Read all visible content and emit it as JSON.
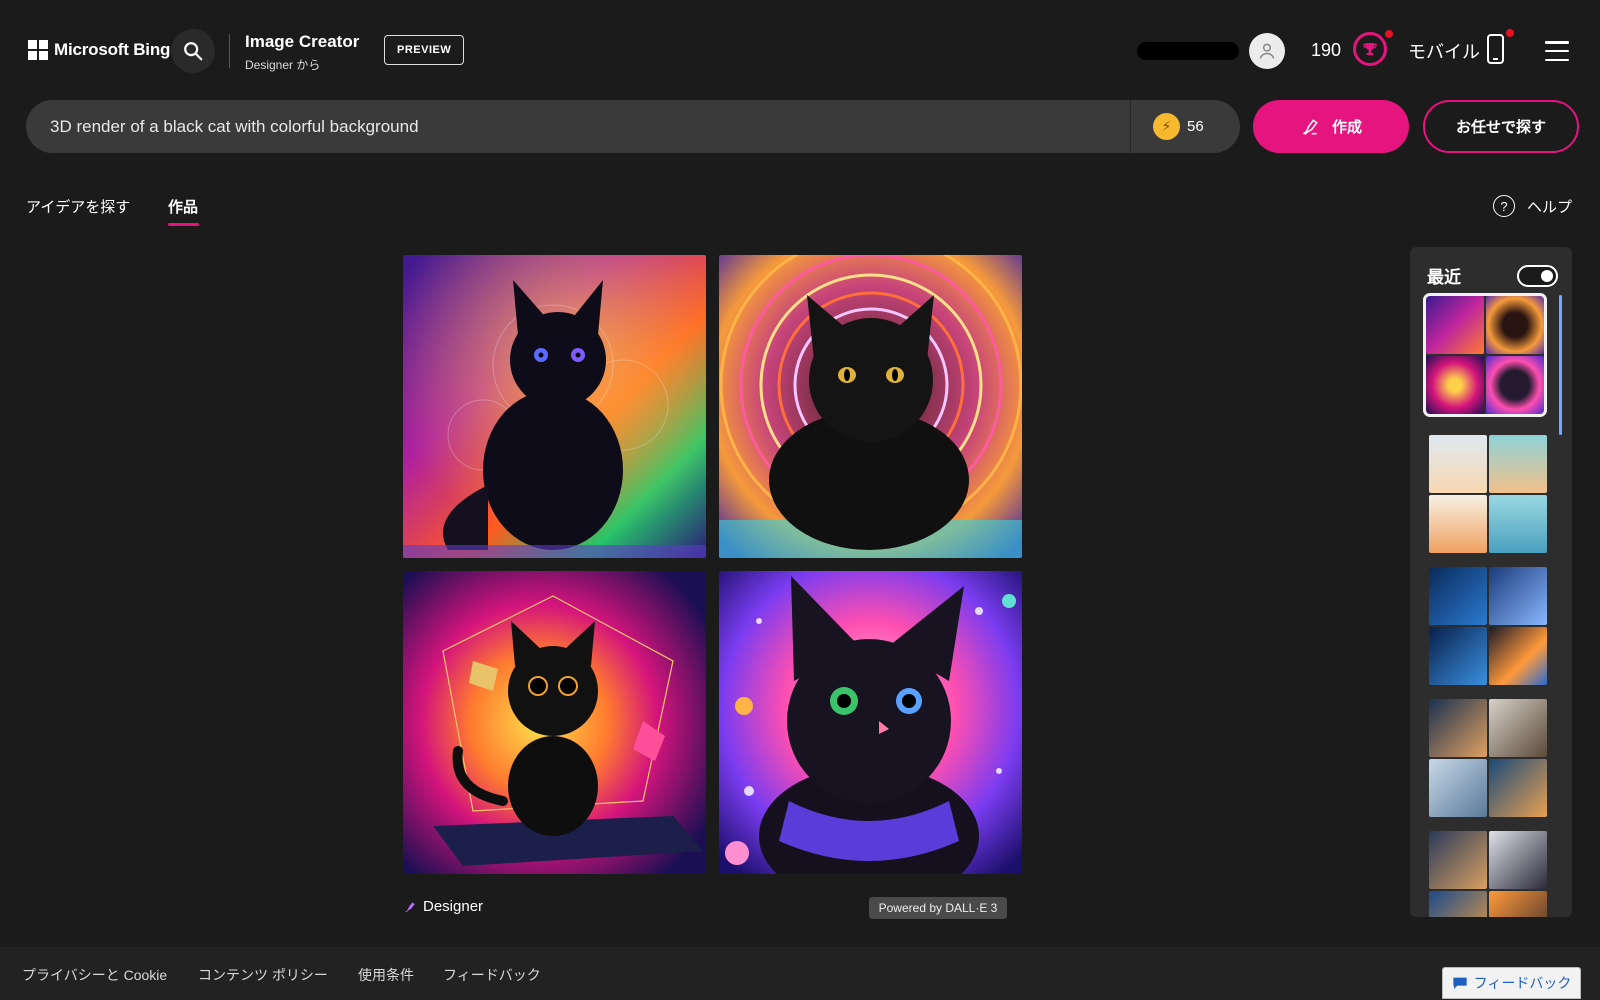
{
  "header": {
    "logo_text": "Microsoft Bing",
    "app_title": "Image Creator",
    "app_subtitle": "Designer から",
    "preview_badge": "PREVIEW",
    "points": "190",
    "mobile_label": "モバイル"
  },
  "search": {
    "query": "3D render of a black cat with colorful background",
    "boosts": "56",
    "create_label": "作成",
    "surprise_label": "お任せで探す"
  },
  "tabs": [
    {
      "label": "アイデアを探す",
      "active": false
    },
    {
      "label": "作品",
      "active": true
    }
  ],
  "help_label": "ヘルプ",
  "results": {
    "images": [
      {
        "subject": "fluffy black cat, neon rainbow background"
      },
      {
        "subject": "black cat lying, concentric neon rings"
      },
      {
        "subject": "glossy black cat figurine, geometric shapes"
      },
      {
        "subject": "black cat with purple bandana, cosmic background"
      }
    ],
    "designer_label": "Designer",
    "powered_label": "Powered by DALL·E 3"
  },
  "recent": {
    "title": "最近",
    "toggle_on": true
  },
  "footer": {
    "links": [
      "プライバシーと Cookie",
      "コンテンツ ポリシー",
      "使用条件",
      "フィードバック"
    ],
    "feedback_button": "フィードバック"
  },
  "colors": {
    "accent": "#e6147e",
    "background": "#1b1b1b",
    "search_bg": "#3a3a3a",
    "coin": "#f5b82e"
  }
}
